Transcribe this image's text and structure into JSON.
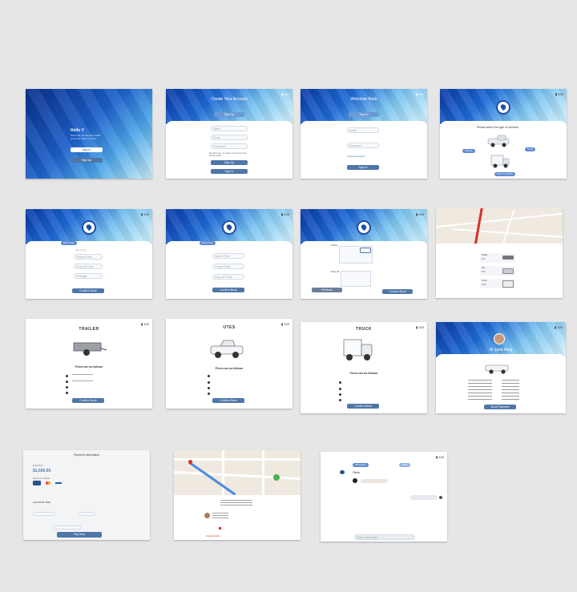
{
  "screens": {
    "splash": {
      "title": "Hello !!",
      "subtitle_lines": [
        "We'll ride into the best deals",
        "just book what you need"
      ],
      "buttons": [
        "Sign In",
        "Sign Up"
      ]
    },
    "signup": {
      "title": "Create Your Account",
      "subtitle": "Sign Up",
      "fields": [
        "Name",
        "Email",
        "Password"
      ],
      "terms": "By signing up, you agree to our terms and privacy policy",
      "buttons": [
        "Sign Up",
        "Sign In"
      ]
    },
    "signin": {
      "title": "Welcome Back",
      "subtitle": "Sign In",
      "fields": [
        "Email",
        "Password"
      ],
      "link": "Forgot password",
      "button": "Sign In"
    },
    "choose": {
      "heading": "Please select the type of services",
      "options": [
        "Vehicle",
        "Truck"
      ],
      "button": "Search Vehicle"
    },
    "booking1": {
      "badge": "Book Now",
      "rows": [
        "Date & Time",
        "Pickup Point",
        "Drop off Point",
        "Package"
      ],
      "button": "Confirm Book"
    },
    "booking2": {
      "badge": "Book Now",
      "rows": [
        "Date & Time",
        "Pickup Point",
        "Drop off Point"
      ],
      "button": "Confirm Book"
    },
    "booking3": {
      "labels": [
        "Pickup",
        "Drop off"
      ],
      "button_left": "Previous",
      "button_right": "Confirm Book"
    },
    "vehicles_list": {
      "items": [
        {
          "name": "Trailer",
          "price": "$75"
        },
        {
          "name": "Ute",
          "price": "$70"
        },
        {
          "name": "Truck",
          "price": "$100"
        }
      ]
    },
    "trailer": {
      "title": "TRAILER",
      "subtitle": "Prices are as follows",
      "button": "Confirm Book"
    },
    "ute": {
      "title": "UTES",
      "subtitle": "Prices are as follows",
      "button": "Confirm Book"
    },
    "truck": {
      "title": "TRUCK",
      "subtitle": "Prices are as follows",
      "button": "Confirm Book"
    },
    "summary": {
      "name": "Hi Jane Ring",
      "button": "Book Payment"
    },
    "payment": {
      "title": "Payment Information",
      "label_total": "Total Price",
      "amount": "$1,500.00",
      "label_method": "Payment method",
      "card_number": "1234 5678 7890",
      "button": "Pay Now"
    },
    "tracking": {
      "button": "Cancel Order"
    },
    "chat": {
      "tabs": [
        "Messages",
        "Chats"
      ],
      "contact": "Olivia",
      "input_placeholder": "Type a message"
    }
  },
  "colors": {
    "background": "#e6e6e6",
    "primary": "#4f76a8",
    "header_dark": "#0b3aa3",
    "header_light": "#d6f3fb"
  }
}
